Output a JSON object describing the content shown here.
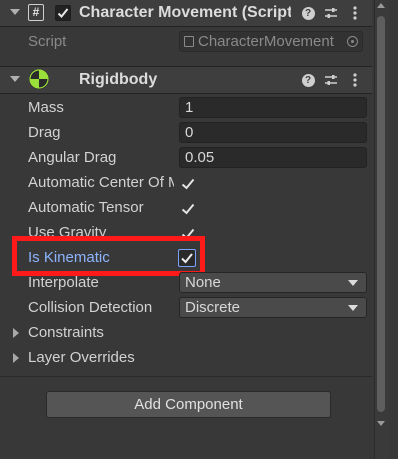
{
  "script_component": {
    "title": "Character Movement (Script)",
    "script_label": "Script",
    "script_value": "CharacterMovement"
  },
  "rigidbody": {
    "title": "Rigidbody",
    "fields": {
      "mass": {
        "label": "Mass",
        "value": "1"
      },
      "drag": {
        "label": "Drag",
        "value": "0"
      },
      "angular_drag": {
        "label": "Angular Drag",
        "value": "0.05"
      },
      "automatic_center_of_mass": {
        "label": "Automatic Center Of Mass",
        "checked": true
      },
      "automatic_tensor": {
        "label": "Automatic Tensor",
        "checked": true
      },
      "use_gravity": {
        "label": "Use Gravity",
        "checked": true
      },
      "is_kinematic": {
        "label": "Is Kinematic",
        "checked": true
      },
      "interpolate": {
        "label": "Interpolate",
        "value": "None"
      },
      "collision_detection": {
        "label": "Collision Detection",
        "value": "Discrete"
      }
    },
    "foldouts": {
      "constraints": "Constraints",
      "layer_overrides": "Layer Overrides"
    }
  },
  "add_component_label": "Add Component",
  "colors": {
    "highlight": "#ff1a1a",
    "kinematic_label": "#8cb4ff"
  }
}
